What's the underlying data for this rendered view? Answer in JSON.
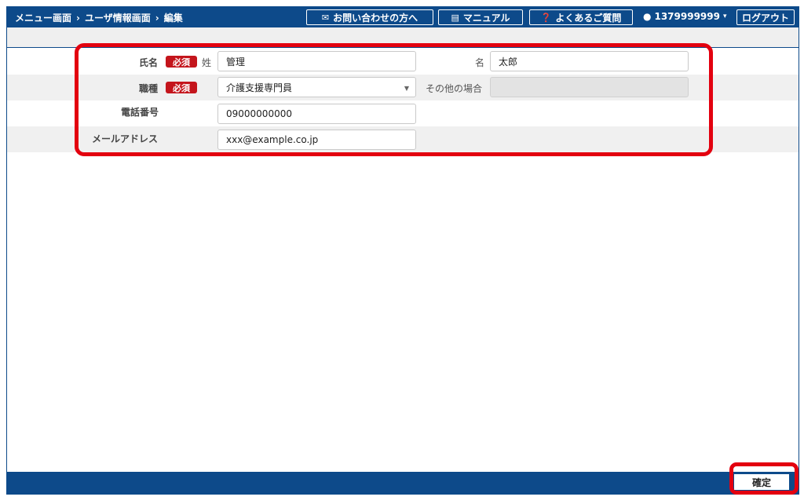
{
  "header": {
    "breadcrumb": [
      "メニュー画面",
      "ユーザ情報画面",
      "編集"
    ],
    "separator": "›",
    "contact_label": "お問い合わせの方へ",
    "manual_label": "マニュアル",
    "faq_label": "よくあるご質問",
    "user_id": "1379999999",
    "logout_label": "ログアウト"
  },
  "form": {
    "required_badge": "必須",
    "name": {
      "label": "氏名",
      "last_label": "姓",
      "last_value": "管理",
      "first_label": "名",
      "first_value": "太郎"
    },
    "job": {
      "label": "職種",
      "value": "介護支援専門員",
      "other_label": "その他の場合",
      "other_value": ""
    },
    "phone": {
      "label": "電話番号",
      "value": "09000000000"
    },
    "email": {
      "label": "メールアドレス",
      "value": "xxx@example.co.jp"
    }
  },
  "footer": {
    "confirm_label": "確定"
  },
  "colors": {
    "brand": "#0d4a8a",
    "required": "#c4151c",
    "highlight": "#e3000f"
  }
}
